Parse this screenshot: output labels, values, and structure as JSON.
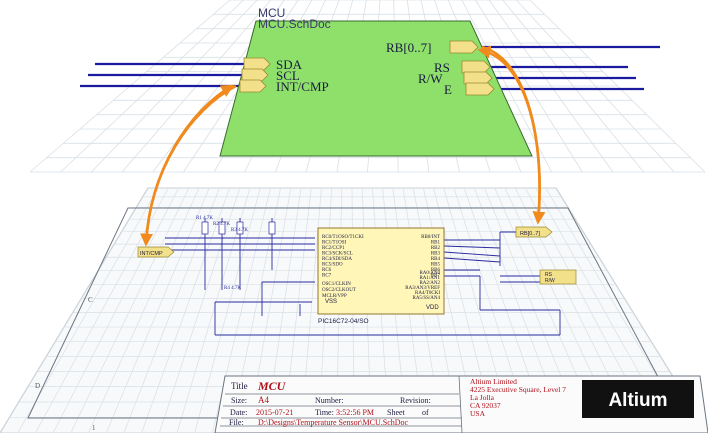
{
  "sheet_block": {
    "name": "MCU",
    "file": "MCU.SchDoc",
    "color": "#8ee06a",
    "ports_left": [
      "SDA",
      "SCL",
      "INT/CMP"
    ],
    "ports_right": [
      "RB[0..7]",
      "RS",
      "R/W",
      "E"
    ]
  },
  "schematic": {
    "chip_part": "PIC16C72-04/SO",
    "chip_pins_left": [
      "RB0/INT",
      "RB1",
      "RB2",
      "RB3",
      "RB4",
      "RB5",
      "RB6",
      "RB7"
    ],
    "chip_pins_right": [
      "RC0/T1OSO/T1CKI",
      "RC1/T1OSI",
      "RC2/CCP1",
      "RC3/SCK/SCL",
      "RC4/SDI/SDA",
      "RC5/SDO",
      "RC6",
      "RC7"
    ],
    "chip_lower_right": [
      "RA0/AN0",
      "RA1/AN1",
      "RA2/AN2",
      "RA3/AN3/VREF",
      "RA4/T0CKI",
      "RA5/SS/AN4"
    ],
    "chip_lower_left": [
      "OSC1/CLKIN",
      "OSC2/CLKOUT",
      "MCLR/VPP"
    ],
    "power": [
      "VSS",
      "VDD"
    ],
    "resistor_labels": [
      "R1 4.7K",
      "R2 4.7K",
      "R3 4.7K",
      "R4 4.7K"
    ],
    "port_right_label": "RB[0..7]",
    "port_left_label": "INT/CMP",
    "rs_block": [
      "RS",
      "R/W"
    ]
  },
  "title_block": {
    "title_label": "Title",
    "title_value": "MCU",
    "size_label": "Size:",
    "size_value": "A4",
    "number_label": "Number:",
    "revision_label": "Revision:",
    "date_label": "Date:",
    "date_value": "2015-07-21",
    "time_label": "Time:",
    "time_value": "3:52:56 PM",
    "sheet_label": "Sheet",
    "of_label": "of",
    "file_label": "File:",
    "file_value": "D:\\Designs\\Temperature Sensor\\MCU.SchDoc",
    "company_lines": [
      "Altium Limited",
      "4225 Executive Square, Level 7",
      "La Jolla",
      "CA 92037",
      "USA"
    ],
    "logo": "Altium"
  },
  "zones": {
    "numbers": [
      "1",
      "2",
      "3",
      "4"
    ],
    "letters": [
      "D",
      "C"
    ]
  },
  "colors": {
    "wire": "#1a1aa0",
    "arrow": "#f08a1c",
    "port_fill": "#f3e08a",
    "grid": "#d8e0e6",
    "title_red": "#b0101a"
  }
}
